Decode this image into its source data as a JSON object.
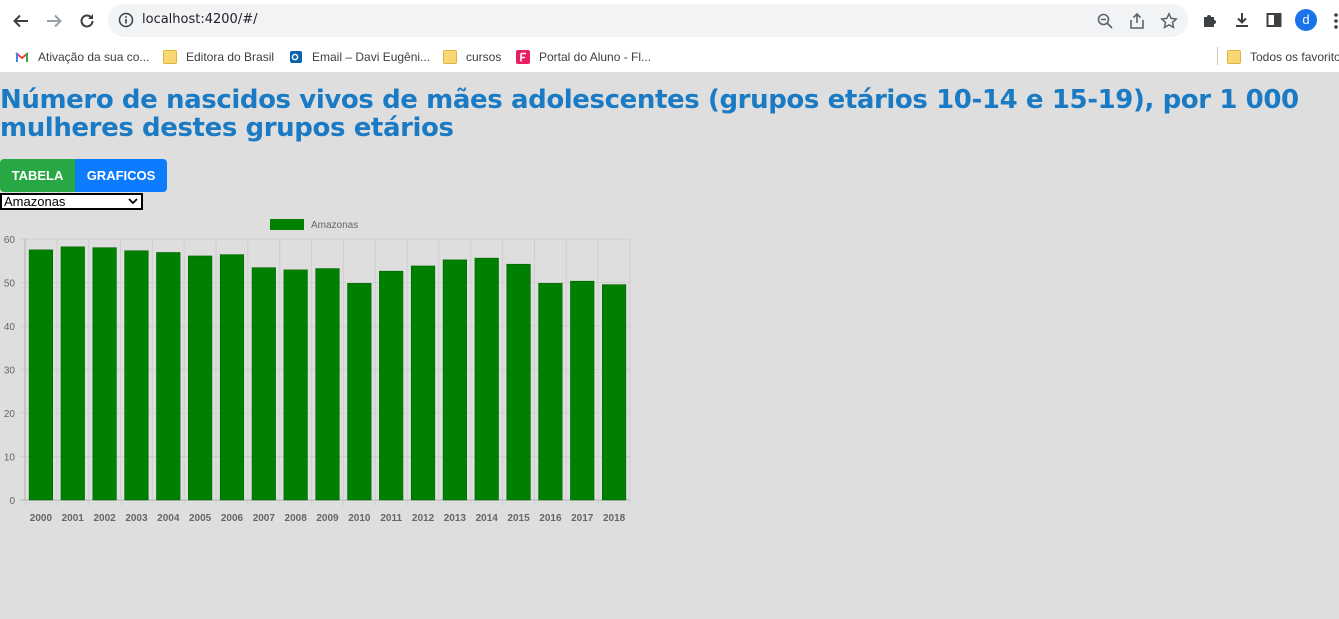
{
  "browser": {
    "url": "localhost:4200/#/",
    "profile_initial": "d",
    "bookmarks": [
      {
        "label": "Ativação da sua co...",
        "icon": "gmail-icon"
      },
      {
        "label": "Editora do Brasil",
        "icon": "folder-icon"
      },
      {
        "label": "Email – Davi Eugêni...",
        "icon": "outlook-icon"
      },
      {
        "label": "cursos",
        "icon": "folder-icon"
      },
      {
        "label": "Portal do Aluno - Fl...",
        "icon": "portal-icon"
      }
    ],
    "other_bookmarks": "Todos os favoritos"
  },
  "page": {
    "title": "Número de nascidos vivos de mães adolescentes (grupos etários 10-14 e 15-19), por 1 000 mulheres destes grupos etários",
    "buttons": {
      "tabela": "TABELA",
      "graficos": "GRAFICOS"
    },
    "select": {
      "value": "Amazonas"
    }
  },
  "colors": {
    "bar": "#008000",
    "title": "#1a7bc4",
    "tabela": "#28a745",
    "graficos": "#0d7bfe"
  },
  "chart_data": {
    "type": "bar",
    "legend": "Amazonas",
    "legend_position": "top",
    "grid": true,
    "ylim": [
      0,
      60
    ],
    "yticks": [
      0,
      10,
      20,
      30,
      40,
      50,
      60
    ],
    "categories": [
      "2000",
      "2001",
      "2002",
      "2003",
      "2004",
      "2005",
      "2006",
      "2007",
      "2008",
      "2009",
      "2010",
      "2011",
      "2012",
      "2013",
      "2014",
      "2015",
      "2016",
      "2017",
      "2018"
    ],
    "series": [
      {
        "name": "Amazonas",
        "values": [
          57.5,
          58.2,
          58.0,
          57.3,
          56.9,
          56.1,
          56.4,
          53.4,
          52.9,
          53.2,
          49.8,
          52.6,
          53.8,
          55.2,
          55.6,
          54.2,
          49.8,
          50.3,
          49.5
        ]
      }
    ]
  }
}
